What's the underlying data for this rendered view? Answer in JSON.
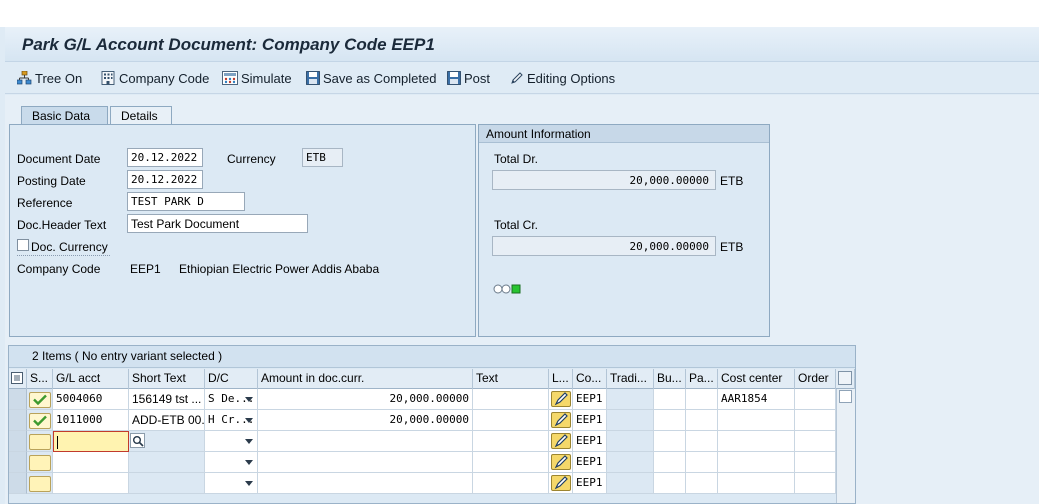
{
  "title": "Park G/L Account Document: Company Code EEP1",
  "toolbar": {
    "tree_on": "Tree On",
    "company_code": "Company Code",
    "simulate": "Simulate",
    "save_completed": "Save as Completed",
    "post": "Post",
    "editing_options": "Editing Options"
  },
  "tabs": {
    "basic_data": "Basic Data",
    "details": "Details"
  },
  "basic": {
    "document_date_label": "Document Date",
    "document_date": "20.12.2022",
    "currency_label": "Currency",
    "currency": "ETB",
    "posting_date_label": "Posting Date",
    "posting_date": "20.12.2022",
    "reference_label": "Reference",
    "reference": "TEST PARK D",
    "header_text_label": "Doc.Header Text",
    "header_text": "Test Park Document",
    "doc_currency_label": "Doc. Currency",
    "company_code_label": "Company Code",
    "company_code": "EEP1",
    "company_name": "Ethiopian Electric Power Addis Ababa"
  },
  "amount": {
    "heading": "Amount Information",
    "total_dr_label": "Total Dr.",
    "total_dr": "20,000.00000",
    "total_dr_currency": "ETB",
    "total_cr_label": "Total Cr.",
    "total_cr": "20,000.00000",
    "total_cr_currency": "ETB"
  },
  "table": {
    "title": "2 Items ( No entry variant selected )",
    "headers": {
      "s": "S...",
      "gl": "G/L acct",
      "short": "Short Text",
      "dc": "D/C",
      "amount": "Amount in doc.curr.",
      "text": "Text",
      "l": "L...",
      "co": "Co...",
      "tradi": "Tradi...",
      "bu": "Bu...",
      "pa": "Pa...",
      "cost": "Cost center",
      "order": "Order"
    },
    "rows": [
      {
        "gl": "5004060",
        "short": "156149 tst ...",
        "dc": "S De...",
        "amount": "20,000.00000",
        "co": "EEP1",
        "cost": "AAR1854"
      },
      {
        "gl": "1011000",
        "short": "ADD-ETB 00...",
        "dc": "H Cr...",
        "amount": "20,000.00000",
        "co": "EEP1",
        "cost": ""
      },
      {
        "gl": "",
        "short": "",
        "dc": "",
        "amount": "",
        "co": "EEP1",
        "cost": ""
      },
      {
        "gl": "",
        "short": "",
        "dc": "",
        "amount": "",
        "co": "EEP1",
        "cost": ""
      },
      {
        "gl": "",
        "short": "",
        "dc": "",
        "amount": "",
        "co": "EEP1",
        "cost": ""
      }
    ]
  }
}
